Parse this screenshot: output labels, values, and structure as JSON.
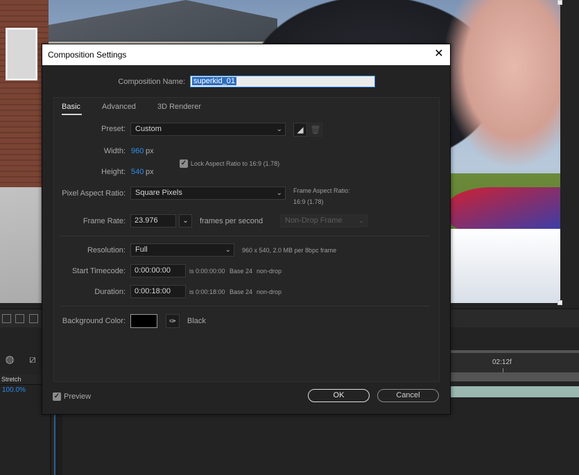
{
  "dialog": {
    "title": "Composition Settings",
    "close_glyph": "✕",
    "composition_name_label": "Composition Name:",
    "composition_name_value": "superkid_01",
    "tabs": [
      {
        "label": "Basic",
        "active": true
      },
      {
        "label": "Advanced",
        "active": false
      },
      {
        "label": "3D Renderer",
        "active": false
      }
    ],
    "preset": {
      "label": "Preset:",
      "value": "Custom"
    },
    "width": {
      "label": "Width:",
      "value": "960",
      "unit": "px"
    },
    "height": {
      "label": "Height:",
      "value": "540",
      "unit": "px"
    },
    "lock_aspect": {
      "label": "Lock Aspect Ratio to 16:9 (1.78)",
      "checked": true
    },
    "pixel_aspect": {
      "label": "Pixel Aspect Ratio:",
      "value": "Square Pixels"
    },
    "frame_aspect": {
      "label": "Frame Aspect Ratio:",
      "value": "16:9 (1.78)"
    },
    "frame_rate": {
      "label": "Frame Rate:",
      "value": "23.976",
      "unit": "frames per second",
      "drop_frame": "Non-Drop Frame"
    },
    "resolution": {
      "label": "Resolution:",
      "value": "Full",
      "info": "960 x 540, 2.0 MB per 8bpc frame"
    },
    "start_timecode": {
      "label": "Start Timecode:",
      "value": "0:00:00:00",
      "is": "is 0:00:00:00",
      "base": "Base 24",
      "mode": "non-drop"
    },
    "duration": {
      "label": "Duration:",
      "value": "0:00:18:00",
      "is": "is 0:00:18:00",
      "base": "Base 24",
      "mode": "non-drop"
    },
    "background_color": {
      "label": "Background Color:",
      "name": "Black",
      "hex": "#000000"
    },
    "preview": {
      "label": "Preview",
      "checked": true
    },
    "ok_label": "OK",
    "cancel_label": "Cancel"
  },
  "timeline": {
    "time_marker": "02:12f",
    "stretch_label": "Stretch",
    "stretch_value": "100.0%"
  },
  "colors": {
    "accent": "#2d8ceb",
    "dialog_bg": "#232323",
    "titlebar_bg": "#ffffff"
  }
}
